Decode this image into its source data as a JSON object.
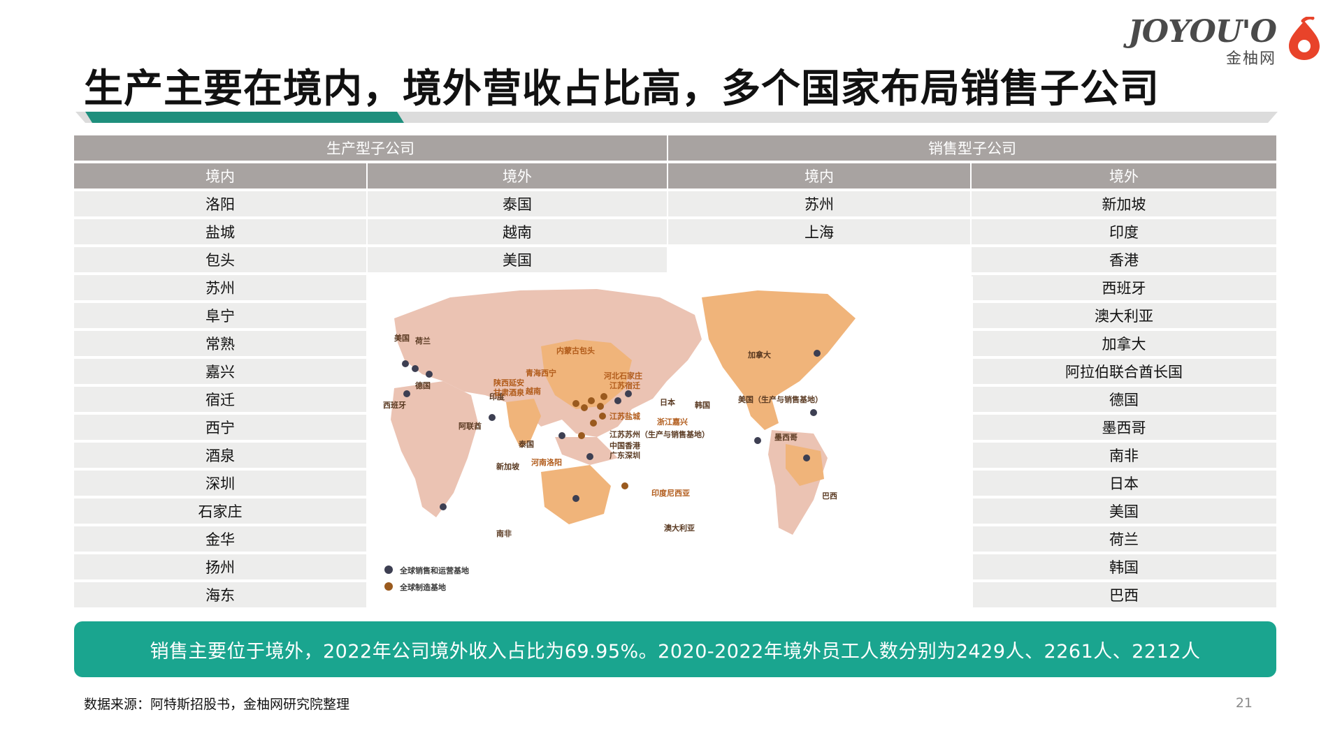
{
  "logo": {
    "wordmark": "JOYOU'O",
    "sub": "金柚网",
    "accent_color": "#e8432a"
  },
  "title": "生产主要在境内，境外营收占比高，多个国家布局销售子公司",
  "table": {
    "group_headers": [
      "生产型子公司",
      "销售型子公司"
    ],
    "sub_headers": [
      "境内",
      "境外",
      "境内",
      "境外"
    ],
    "production_domestic": [
      "洛阳",
      "盐城",
      "包头",
      "苏州",
      "阜宁",
      "常熟",
      "嘉兴",
      "宿迁",
      "西宁",
      "酒泉",
      "深圳",
      "石家庄",
      "金华",
      "扬州",
      "海东"
    ],
    "production_overseas": [
      "泰国",
      "越南",
      "美国"
    ],
    "sales_domestic": [
      "苏州",
      "上海"
    ],
    "sales_overseas": [
      "新加坡",
      "印度",
      "香港",
      "西班牙",
      "澳大利亚",
      "加拿大",
      "阿拉伯联合酋长国",
      "德国",
      "墨西哥",
      "南非",
      "日本",
      "美国",
      "荷兰",
      "韩国",
      "巴西"
    ]
  },
  "map": {
    "labels": [
      "美国",
      "荷兰",
      "德国",
      "西班牙",
      "阿联酋",
      "泰国",
      "印度",
      "越南",
      "新加坡",
      "内蒙古包头",
      "青海西宁",
      "陕西延安",
      "甘肃酒泉",
      "河北石家庄",
      "江苏宿迁",
      "日本",
      "韩国",
      "江苏盐城",
      "浙江嘉兴",
      "江苏苏州（生产与销售基地）",
      "中国香港",
      "广东深圳",
      "河南洛阳",
      "印度尼西亚",
      "澳大利亚",
      "南非",
      "加拿大",
      "美国（生产与销售基地）",
      "墨西哥",
      "巴西"
    ],
    "legend": [
      "全球销售和运营基地",
      "全球制造基地"
    ],
    "land_color": "#ebc3b3",
    "highlight_color": "#f0b47a",
    "sales_pin_color": "#3d3f52",
    "mfg_pin_color": "#9a5a1e"
  },
  "banner": "销售主要位于境外，2022年公司境外收入占比为69.95%。2020-2022年境外员工人数分别为2429人、2261人、2212人",
  "source": "数据来源：阿特斯招股书，金柚网研究院整理",
  "page_number": "21",
  "colors": {
    "header_gray": "#a8a3a1",
    "row_gray": "#ededec",
    "teal": "#1aa58f"
  }
}
